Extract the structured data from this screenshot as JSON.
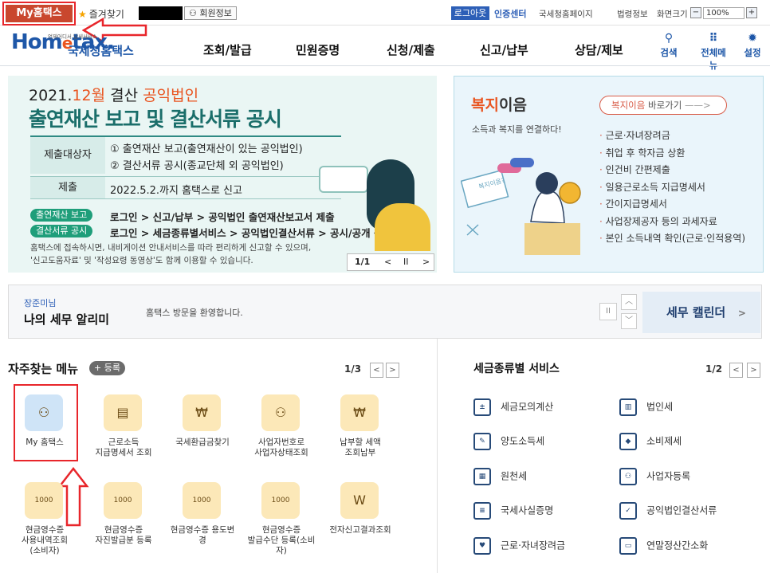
{
  "topbar": {
    "mytax_label": "My홈택스",
    "fav_label": "즐겨찾기",
    "member_label": "회원정보",
    "logout_label": "로그아웃",
    "cert_label": "인증센터",
    "util_links": [
      "국세청홈페이지",
      "법령정보"
    ],
    "zoom_label": "화면크기",
    "zoom_value": "100%",
    "zoom_minus": "−",
    "zoom_plus": "+"
  },
  "header": {
    "logo_text_a": "Hom",
    "logo_text_e": "e",
    "logo_text_b": "tax.",
    "logo_sub": "국세청홈택스",
    "logo_tiny": "언제어디서 납세서비스",
    "nav": [
      "조회/발급",
      "민원증명",
      "신청/제출",
      "신고/납부",
      "상담/제보"
    ],
    "icons": [
      {
        "label": "검색",
        "icon": "search-icon"
      },
      {
        "label": "전체메뉴",
        "icon": "grid-menu-icon"
      },
      {
        "label": "설정",
        "icon": "gear-icon"
      }
    ]
  },
  "banner": {
    "date_prefix": "2021.",
    "date_month": "12월",
    "date_mid": " 결산 ",
    "date_org": "공익법인",
    "title": "출연재산 보고 및 결산서류 공시",
    "rows": [
      {
        "key": "제출대상자",
        "v1": "① 출연재산 보고(출연재산이 있는 공익법인)",
        "v2": "② 결산서류 공시(종교단체 외 공익법인)"
      },
      {
        "key": "제출",
        "v1": "2022.5.2.까지 홈택스로 신고"
      }
    ],
    "pill1": "출연재산 보고",
    "pill1_text": "로그인 > 신고/납부 > 공익법인 출연재산보고서 제출",
    "pill2": "결산서류 공시",
    "pill2_text": "로그인 > 세금종류별서비스 > 공익법인결산서류 > 공시/공개 등록하기",
    "note1": "홈택스에 접속하시면, 내비게이션 안내서비스를 따라 편리하게 신고할 수 있으며,",
    "note2": "'신고도움자료' 및 '작성요령 동영상'도 함께 이용할 수 있습니다.",
    "page": "1/1",
    "prev": "<",
    "pause": "II",
    "next": ">"
  },
  "welfare": {
    "title_hl": "복지",
    "title_rest": "이음",
    "sub": "소득과 복지를 연결하다!",
    "btn_hl": "복지이음",
    "btn_rest": " 바로가기",
    "btn_arrow": "——>",
    "items": [
      "근로·자녀장려금",
      "취업 후 학자금 상환",
      "인건비 간편제출",
      "일용근로소득 지급명세서",
      "간이지급명세서",
      "사업장제공자 등의 과세자료",
      "본인 소득내역 확인(근로·인적용역)"
    ],
    "illu_text": "복지이음?"
  },
  "notice": {
    "name": "장준미님",
    "title": "나의 세무 알리미",
    "message": "홈택스 방문을 환영합니다.",
    "pause": "II",
    "up": "︿",
    "down": "﹀",
    "calendar": "세무 캘린더",
    "calendar_arrow": ">"
  },
  "freq": {
    "title": "자주찾는 메뉴",
    "add": "+ 등록",
    "page": "1/3",
    "prev": "<",
    "next": ">",
    "items": [
      {
        "label": "My 홈택스",
        "icon": "user-icon",
        "glyph": "⚇"
      },
      {
        "label": "근로소득\n지급명세서 조회",
        "icon": "wallet-icon",
        "glyph": "▤"
      },
      {
        "label": "국세환급금찾기",
        "icon": "refund-icon",
        "glyph": "₩"
      },
      {
        "label": "사업자번호로\n사업자상태조회",
        "icon": "business-search-icon",
        "glyph": "⚇"
      },
      {
        "label": "납부할 세액\n조회납부",
        "icon": "money-bag-icon",
        "glyph": "₩"
      },
      {
        "label": "현금영수증\n사용내역조회\n(소비자)",
        "icon": "receipt-icon",
        "glyph": "1000"
      },
      {
        "label": "현금영수증\n자진발급분 등록",
        "icon": "receipt-icon",
        "glyph": "1000"
      },
      {
        "label": "현금영수증 용도변\n경",
        "icon": "receipt-icon",
        "glyph": "1000"
      },
      {
        "label": "현금영수증\n발급수단 등록(소비\n자)",
        "icon": "receipt-icon",
        "glyph": "1000"
      },
      {
        "label": "전자신고결과조회",
        "icon": "e-filing-icon",
        "glyph": "W"
      }
    ]
  },
  "services": {
    "title": "세금종류별 서비스",
    "page": "1/2",
    "prev": "<",
    "next": ">",
    "items": [
      {
        "label": "세금모의계산",
        "icon": "calculator-icon",
        "glyph": "±"
      },
      {
        "label": "법인세",
        "icon": "building-icon",
        "glyph": "▥"
      },
      {
        "label": "양도소득세",
        "icon": "document-edit-icon",
        "glyph": "✎"
      },
      {
        "label": "소비제세",
        "icon": "diamond-icon",
        "glyph": "◆"
      },
      {
        "label": "원천세",
        "icon": "calendar-doc-icon",
        "glyph": "▦"
      },
      {
        "label": "사업자등록",
        "icon": "person-icon",
        "glyph": "⚇"
      },
      {
        "label": "국세사실증명",
        "icon": "document-icon",
        "glyph": "≡"
      },
      {
        "label": "공익법인결산서류",
        "icon": "clipboard-check-icon",
        "glyph": "✓"
      },
      {
        "label": "근로·자녀장려금",
        "icon": "heart-icon",
        "glyph": "♥"
      },
      {
        "label": "연말정산간소화",
        "icon": "car-icon",
        "glyph": "▭"
      }
    ]
  }
}
